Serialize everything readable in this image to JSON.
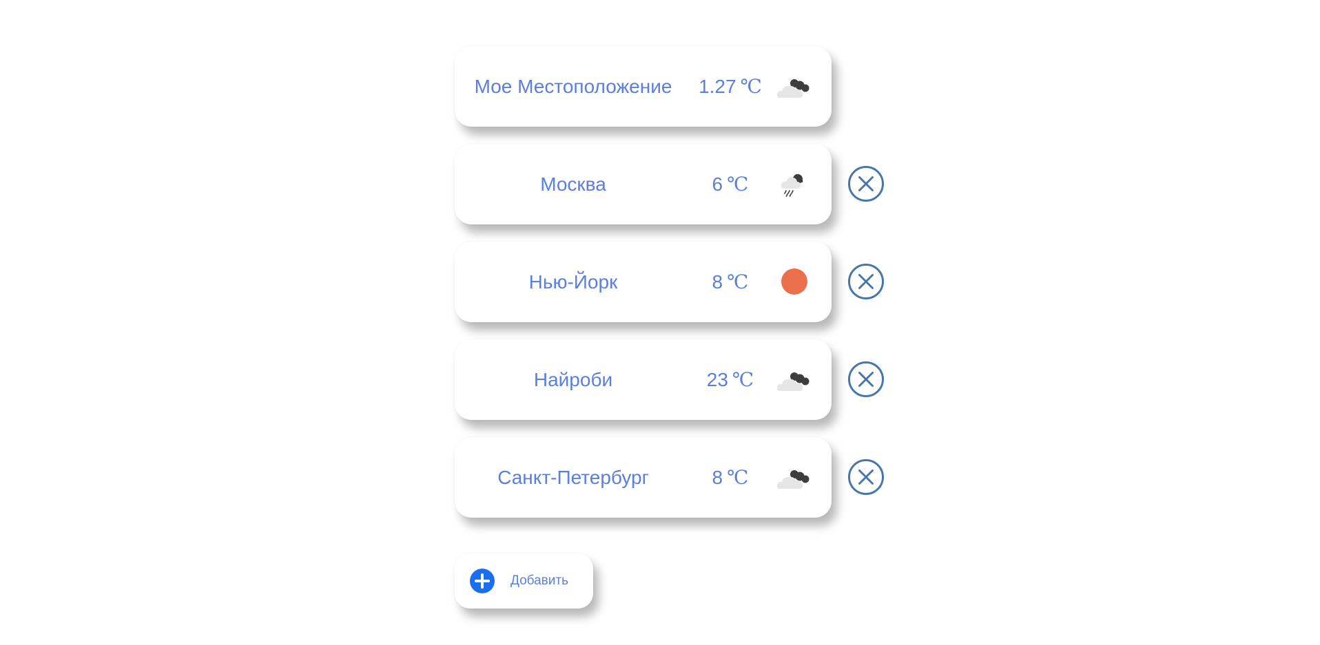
{
  "cities": [
    {
      "name": "Мое Местоположение",
      "temp": "1.27",
      "unit": "℃",
      "icon": "cloudy-icon",
      "removable": false
    },
    {
      "name": "Москва",
      "temp": "6",
      "unit": "℃",
      "icon": "rain-cloud-icon",
      "removable": true
    },
    {
      "name": "Нью-Йорк",
      "temp": "8",
      "unit": "℃",
      "icon": "sun-icon",
      "removable": true
    },
    {
      "name": "Найроби",
      "temp": "23",
      "unit": "℃",
      "icon": "cloudy-icon",
      "removable": true
    },
    {
      "name": "Санкт-Петербург",
      "temp": "8",
      "unit": "℃",
      "icon": "cloudy-icon",
      "removable": true
    }
  ],
  "add_button": {
    "label": "Добавить",
    "icon": "plus-circle-icon"
  },
  "colors": {
    "text": "#5b7fe0",
    "remove_icon": "#4677a8",
    "add_icon": "#1a6ff0",
    "sun": "#ec6f4c",
    "cloud_light": "#e6e6e6",
    "cloud_dark": "#3d3d3d"
  }
}
